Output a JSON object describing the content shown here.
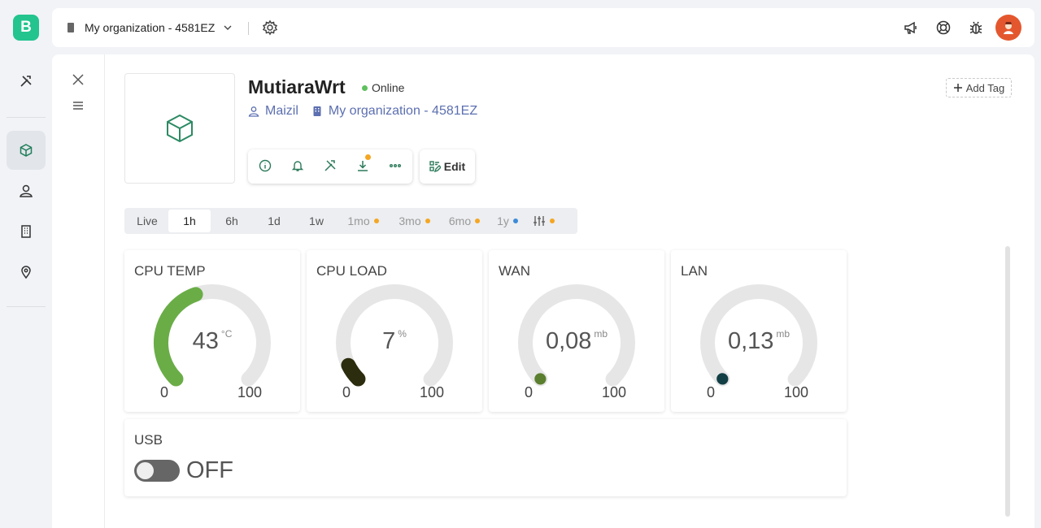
{
  "app": {
    "logo_letter": "B"
  },
  "topbar": {
    "org_name": "My organization - 4581EZ"
  },
  "device": {
    "name": "MutiaraWrt",
    "status": "Online",
    "owner": "Maizil",
    "organization": "My organization - 4581EZ",
    "edit_label": "Edit",
    "add_tag_label": "Add Tag"
  },
  "time_ranges": [
    {
      "label": "Live"
    },
    {
      "label": "1h",
      "selected": true
    },
    {
      "label": "6h"
    },
    {
      "label": "1d"
    },
    {
      "label": "1w"
    },
    {
      "label": "1mo",
      "dot": "#f5a623"
    },
    {
      "label": "3mo",
      "dot": "#f5a623"
    },
    {
      "label": "6mo",
      "dot": "#f5a623"
    },
    {
      "label": "1y",
      "dot": "#3d8bd9"
    }
  ],
  "widgets": {
    "cpu_temp": {
      "title": "CPU TEMP",
      "value": "43",
      "unit": "°C",
      "min": "0",
      "max": "100",
      "fraction": 0.43,
      "color": "#6aad47"
    },
    "cpu_load": {
      "title": "CPU LOAD",
      "value": "7",
      "unit": "%",
      "min": "0",
      "max": "100",
      "fraction": 0.07,
      "color": "#2c2c0e"
    },
    "wan": {
      "title": "WAN",
      "value": "0,08",
      "unit": "mb",
      "min": "0",
      "max": "100",
      "fraction": 0.0008,
      "color": "#5a7f2f"
    },
    "lan": {
      "title": "LAN",
      "value": "0,13",
      "unit": "mb",
      "min": "0",
      "max": "100",
      "fraction": 0.0013,
      "color": "#123f45"
    },
    "usb": {
      "title": "USB",
      "state": "OFF"
    }
  },
  "colors": {
    "accent": "#23c48e",
    "online": "#5fc05e",
    "link": "#5c6fb0"
  }
}
